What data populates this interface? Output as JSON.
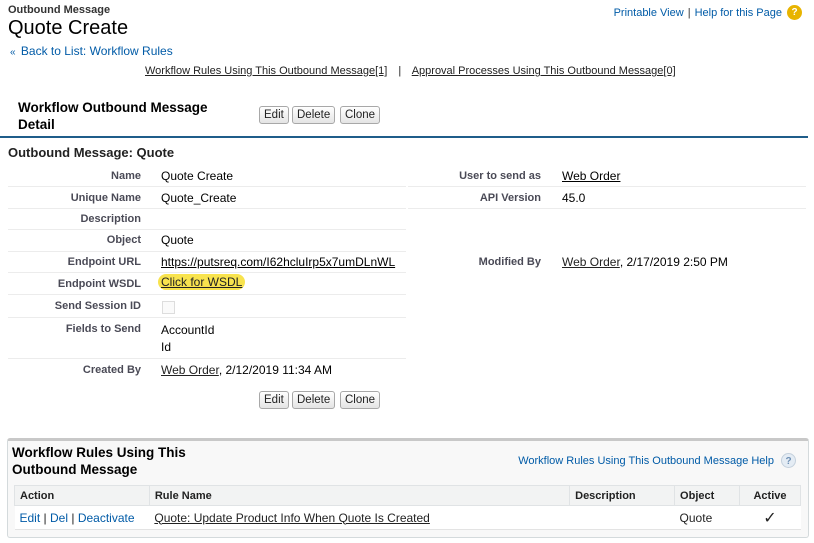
{
  "header": {
    "object_type": "Outbound Message",
    "title": "Quote Create",
    "printable_view": "Printable View",
    "separator": "|",
    "help_link": "Help for this Page",
    "help_icon": "help-icon",
    "back_arrow": "«",
    "back_link": "Back to List: Workflow Rules"
  },
  "related_links": {
    "workflow_rules": "Workflow Rules Using This Outbound Message",
    "workflow_rules_count": "[1]",
    "separator": "|",
    "approval_processes": "Approval Processes Using This Outbound Message",
    "approval_processes_count": "[0]"
  },
  "detail": {
    "header": "Workflow Outbound Message Detail",
    "buttons": {
      "edit": "Edit",
      "delete": "Delete",
      "clone": "Clone"
    },
    "section_title": "Outbound Message: Quote",
    "fields": {
      "name_label": "Name",
      "name_value": "Quote Create",
      "user_label": "User to send as",
      "user_value": "Web Order",
      "unique_label": "Unique Name",
      "unique_value": "Quote_Create",
      "api_label": "API Version",
      "api_value": "45.0",
      "description_label": "Description",
      "description_value": "",
      "object_label": "Object",
      "object_value": "Quote",
      "endpoint_url_label": "Endpoint URL",
      "endpoint_url_value": "https://putsreq.com/I62hcluIrp5x7umDLnWL",
      "modified_label": "Modified By",
      "modified_user": "Web Order",
      "modified_date": ", 2/17/2019 2:50 PM",
      "wsdl_label": "Endpoint WSDL",
      "wsdl_value": "Click for WSDL",
      "session_label": "Send Session ID",
      "fields_label": "Fields to Send",
      "fields_value_1": "AccountId",
      "fields_value_2": "Id",
      "created_label": "Created By",
      "created_user": "Web Order",
      "created_date": ", 2/12/2019 11:34 AM"
    }
  },
  "related_list": {
    "title": "Workflow Rules Using This Outbound Message",
    "help": "Workflow Rules Using This Outbound Message Help",
    "help_icon": "help-icon",
    "columns": [
      "Action",
      "Rule Name",
      "Description",
      "Object",
      "Active"
    ],
    "rows": [
      {
        "action_edit": "Edit",
        "action_sep": "|",
        "action_del": "Del",
        "action_deactivate": "Deactivate",
        "rule_name": "Quote: Update Product Info When Quote Is Created",
        "description": "",
        "object": "Quote",
        "active": "✓"
      }
    ]
  }
}
